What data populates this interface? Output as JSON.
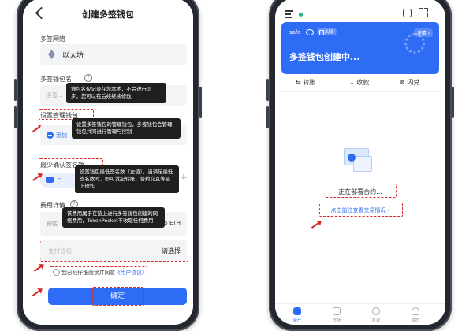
{
  "left_screen": {
    "title": "创建多签钱包",
    "network": {
      "label": "多签网络",
      "value": "以太坊"
    },
    "wallet_name": {
      "label": "多签钱包名",
      "placeholder": "多签...",
      "tooltip": "钱包名仅记录在您本地，不会进行同步，您可以在后续继续修改"
    },
    "managers": {
      "label": "设置管理钱包",
      "add_text": "添加",
      "tooltip": "设置多签钱包的管理钱包，多签钱包会管理钱包共同进行管理与控制"
    },
    "min_signatures": {
      "label": "最少确认签名数",
      "tooltip": "设置钱包最低签名数（左值），当满足最低签名数时，即可发起转账、合约交互等链上操作",
      "stepper_plus": "+"
    },
    "fee": {
      "label": "费用详情",
      "estimate_prefix": "预估",
      "estimate_suffix": "5 ETH",
      "tooltip": "该费用属于在链上进行多签钱包创建的网络费用，TokenPocket不收取任何费用"
    },
    "pay_wallet": {
      "label": "支付钱包",
      "action": "请选择"
    },
    "agreement": {
      "text": "我已经仔细阅读并同意",
      "link": "《用户协议》"
    },
    "confirm_button": "确定"
  },
  "right_screen": {
    "wallet_card": {
      "safe_label": "safe",
      "signers_badge": "2/3",
      "details_link": "详情 ›",
      "status": "多签钱包创建中..."
    },
    "actions": [
      "转账",
      "收款",
      "闪兑"
    ],
    "deploying_text": "正在部署合约...",
    "view_progress_link": "点击前往查看交易情况 ›",
    "tabs": [
      "资产",
      "市场",
      "发现",
      "我的"
    ]
  },
  "colors": {
    "accent": "#2f6cf5",
    "highlight": "#d9292a",
    "tooltip_bg": "#1f1f1f",
    "frame": "#23272f"
  }
}
